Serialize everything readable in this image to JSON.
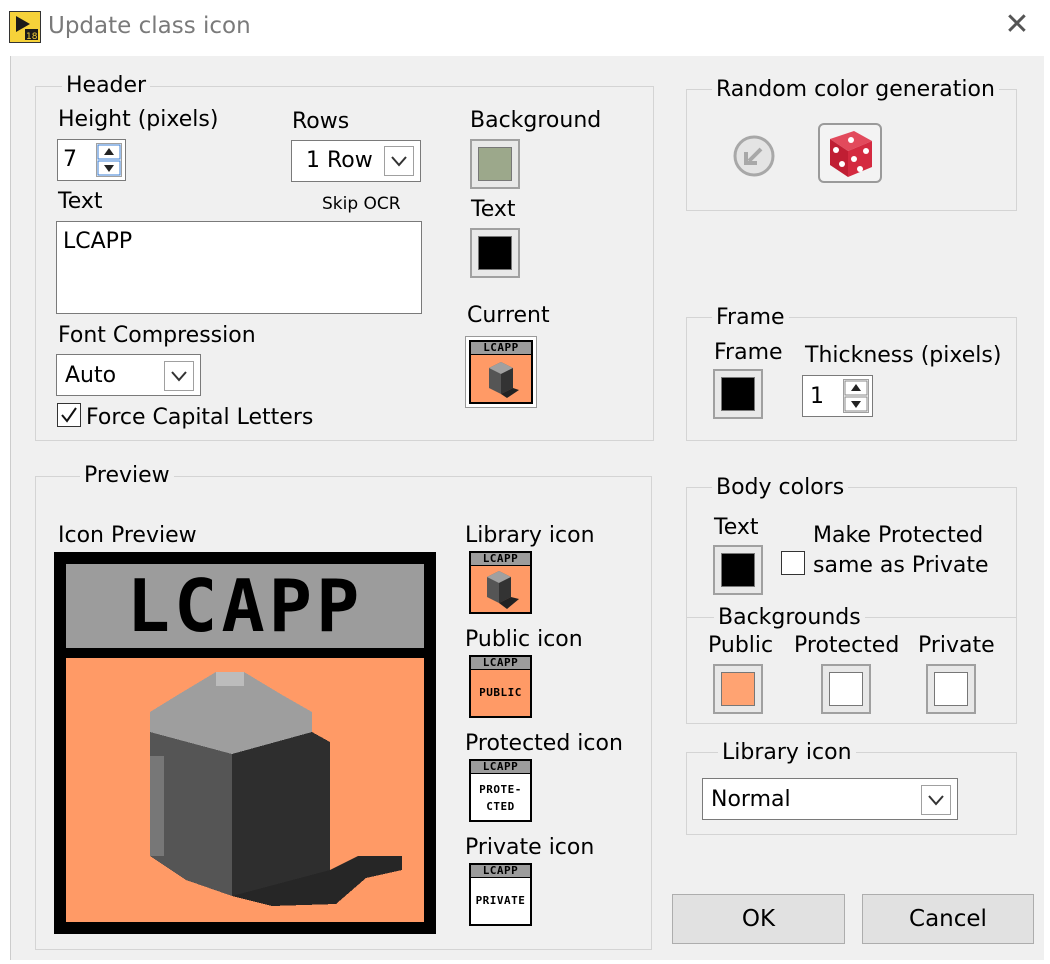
{
  "window": {
    "title": "Update class icon",
    "close_glyph": "✕"
  },
  "header": {
    "group_label": "Header",
    "height_label": "Height (pixels)",
    "height_value": "7",
    "rows_label": "Rows",
    "rows_value": "1 Row",
    "text_label": "Text",
    "skip_ocr_label": "Skip OCR",
    "text_value": "LCAPP",
    "font_compression_label": "Font Compression",
    "font_compression_value": "Auto",
    "force_capital_label": "Force Capital Letters",
    "force_capital_checked": true,
    "background_label": "Background",
    "text_color_label": "Text",
    "current_label": "Current",
    "background_color": "#9ca88b",
    "text_color": "#000000"
  },
  "random_color": {
    "group_label": "Random color generation"
  },
  "frame": {
    "group_label": "Frame",
    "frame_label": "Frame",
    "thickness_label": "Thickness (pixels)",
    "thickness_value": "1",
    "frame_color": "#000000"
  },
  "body_colors": {
    "group_label": "Body colors",
    "text_label": "Text",
    "text_color": "#000000",
    "make_protected_label_line1": "Make Protected",
    "make_protected_label_line2": "same as Private",
    "make_protected_checked": false,
    "backgrounds_label": "Backgrounds",
    "public_label": "Public",
    "protected_label": "Protected",
    "private_label": "Private",
    "public_color": "#ffa372",
    "protected_color": "#ffffff",
    "private_color": "#ffffff"
  },
  "library_icon": {
    "group_label": "Library icon",
    "value": "Normal"
  },
  "preview": {
    "group_label": "Preview",
    "icon_preview_label": "Icon Preview",
    "header_text": "LCAPP",
    "library_icon_label": "Library icon",
    "public_icon_label": "Public icon",
    "public_icon_text": "PUBLIC",
    "protected_icon_label": "Protected icon",
    "protected_icon_text_line1": "PROTE-",
    "protected_icon_text_line2": "CTED",
    "private_icon_label": "Private icon",
    "private_icon_text": "PRIVATE",
    "icon_body_color": "#ff9a66",
    "icon_header_color": "#9c9c9c"
  },
  "buttons": {
    "ok_label": "OK",
    "cancel_label": "Cancel"
  }
}
